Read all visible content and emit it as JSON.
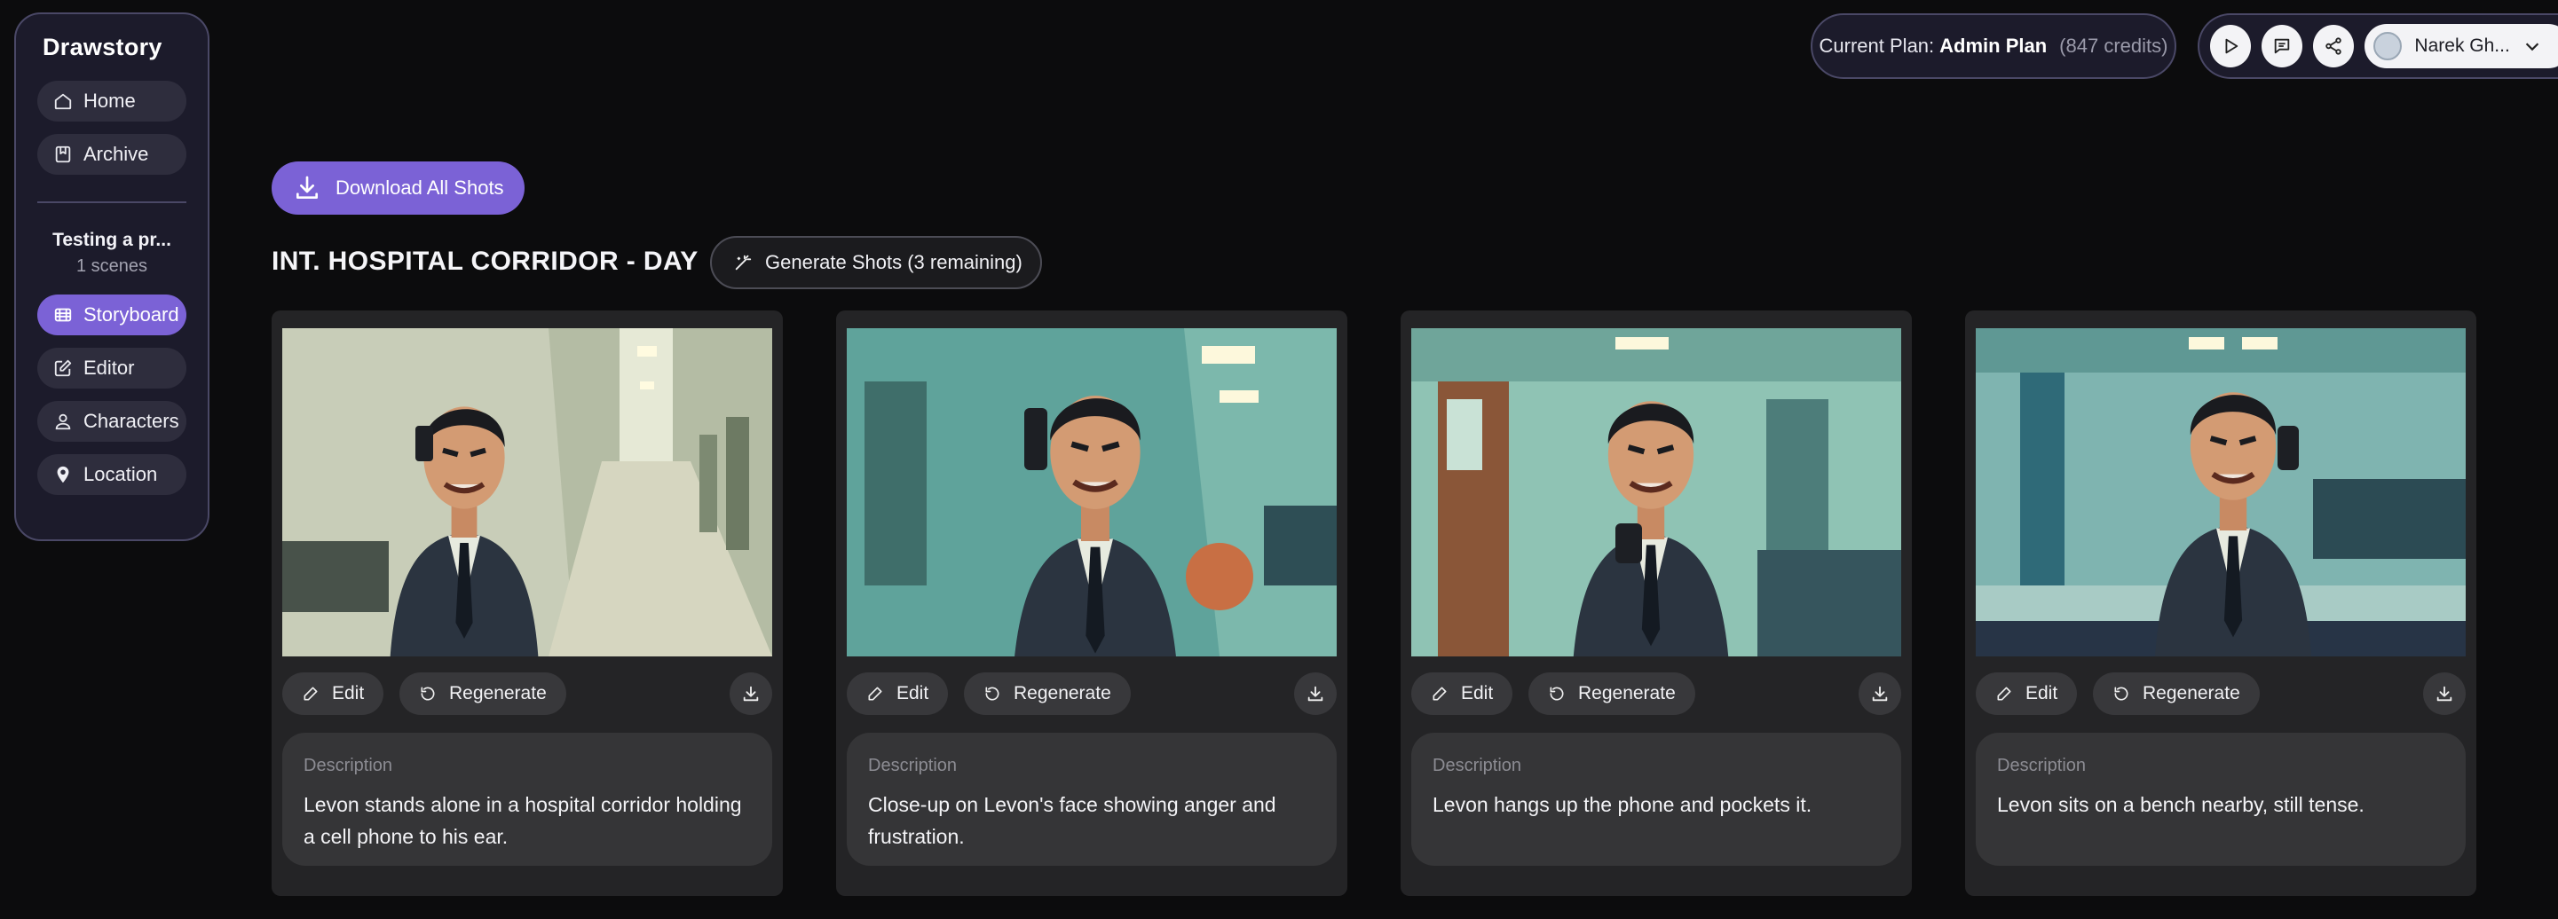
{
  "app": {
    "name": "Drawstory"
  },
  "sidebar": {
    "top_items": [
      {
        "label": "Home",
        "icon": "home-icon"
      },
      {
        "label": "Archive",
        "icon": "bookmark-icon"
      }
    ],
    "project": {
      "title": "Testing a pr...",
      "subtitle": "1 scenes"
    },
    "items": [
      {
        "label": "Storyboard",
        "icon": "film-icon",
        "active": true
      },
      {
        "label": "Editor",
        "icon": "pencil-square-icon"
      },
      {
        "label": "Characters",
        "icon": "user-icon"
      },
      {
        "label": "Location",
        "icon": "map-pin-icon"
      }
    ]
  },
  "header": {
    "plan_prefix": "Current Plan:",
    "plan_name": "Admin Plan",
    "credits": "(847 credits)",
    "user_name": "Narek Gh...",
    "tools": [
      "play-icon",
      "chat-icon",
      "share-icon"
    ]
  },
  "main": {
    "download_all_label": "Download All Shots",
    "scene_title": "INT. HOSPITAL CORRIDOR - DAY",
    "generate_label": "Generate Shots (3 remaining)",
    "edit_label": "Edit",
    "regenerate_label": "Regenerate",
    "description_label": "Description",
    "shots": [
      {
        "description": "Levon stands alone in a hospital corridor holding a cell phone to his ear."
      },
      {
        "description": "Close-up on Levon's face showing anger and frustration."
      },
      {
        "description": "Levon hangs up the phone and pockets it."
      },
      {
        "description": "Levon sits on a bench nearby, still tense."
      }
    ]
  },
  "colors": {
    "background": "#0c0c0d",
    "accent": "#7b62d6",
    "sidebar_bg": "#1c1b2b",
    "card_bg": "#242426"
  }
}
